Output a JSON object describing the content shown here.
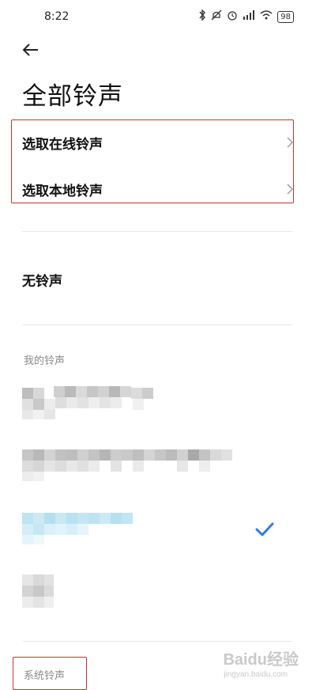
{
  "status_bar": {
    "time": "8:22",
    "battery": "98",
    "icons": [
      "bluetooth-icon",
      "mute-icon",
      "alarm-icon",
      "signal-icon",
      "wifi-icon",
      "battery-icon"
    ]
  },
  "header": {
    "title": "全部铃声"
  },
  "options": [
    {
      "label": "选取在线铃声"
    },
    {
      "label": "选取本地铃声"
    }
  ],
  "none_option": {
    "label": "无铃声"
  },
  "my_ringtones": {
    "section_title": "我的铃声",
    "selected_index": 2
  },
  "system_ringtones": {
    "section_title": "系统铃声"
  },
  "colors": {
    "accent": "#2f7ed8",
    "highlight": "#c0392b",
    "section_label": "#8a8a8a"
  },
  "watermark": {
    "text": "Baidu经验",
    "sub": "jingyan.baidu.com"
  }
}
